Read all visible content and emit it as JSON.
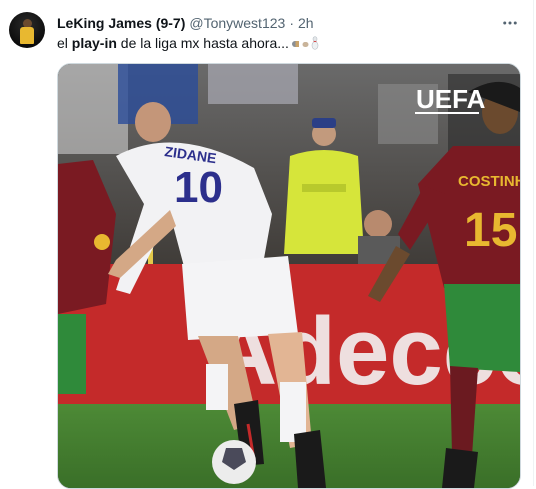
{
  "tweet": {
    "display_name": "LeKing James (9-7)",
    "handle": "@Tonywest123",
    "separator": "·",
    "time": "2h",
    "more_icon": "more-horizontal-icon",
    "text_prefix": "el ",
    "text_bold": "play-in",
    "text_suffix": " de la liga mx hasta ahora...",
    "emojis": [
      "pill-icon",
      "pill-icon",
      "bowling-pin-icon"
    ]
  },
  "media": {
    "watermark": "UEFA",
    "player_left_name": "ZIDANE",
    "player_left_number": "10",
    "player_right_name": "COSTINHA",
    "player_right_number": "15",
    "ad_board_text": "Adecco"
  },
  "colors": {
    "name": "#0f1419",
    "secondary": "#536471",
    "jersey_white": "#f2f2f4",
    "jersey_number": "#2c2f8c",
    "jersey_red": "#7a1a22",
    "jersey_gold": "#e8b830",
    "shorts_green": "#2f8a3a",
    "ad_board_red": "#c42a2a",
    "pitch_green": "#3f7a2c"
  }
}
